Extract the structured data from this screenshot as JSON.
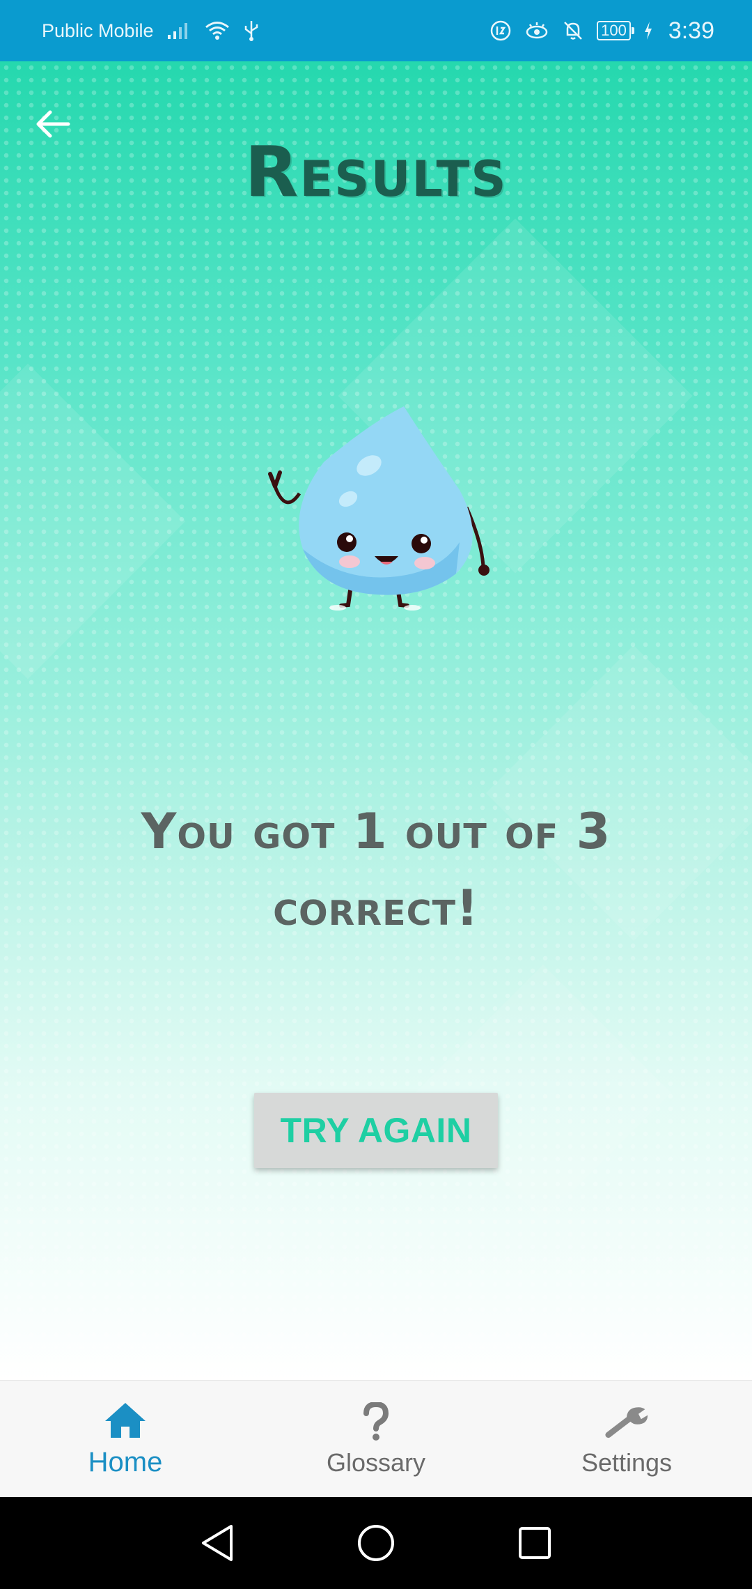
{
  "status_bar": {
    "carrier": "Public Mobile",
    "battery": "100",
    "time": "3:39"
  },
  "header": {
    "title": "Results"
  },
  "result": {
    "message": "You got 1 out of 3 correct!"
  },
  "actions": {
    "try_again_label": "TRY AGAIN"
  },
  "bottom_nav": {
    "items": [
      {
        "label": "Home",
        "icon": "home-icon",
        "active": true
      },
      {
        "label": "Glossary",
        "icon": "question-icon",
        "active": false
      },
      {
        "label": "Settings",
        "icon": "wrench-icon",
        "active": false
      }
    ]
  },
  "colors": {
    "status_bar": "#0a9bcf",
    "title": "#1b5e4f",
    "button_text": "#1ecfa3",
    "active_nav": "#1b8fc4"
  }
}
